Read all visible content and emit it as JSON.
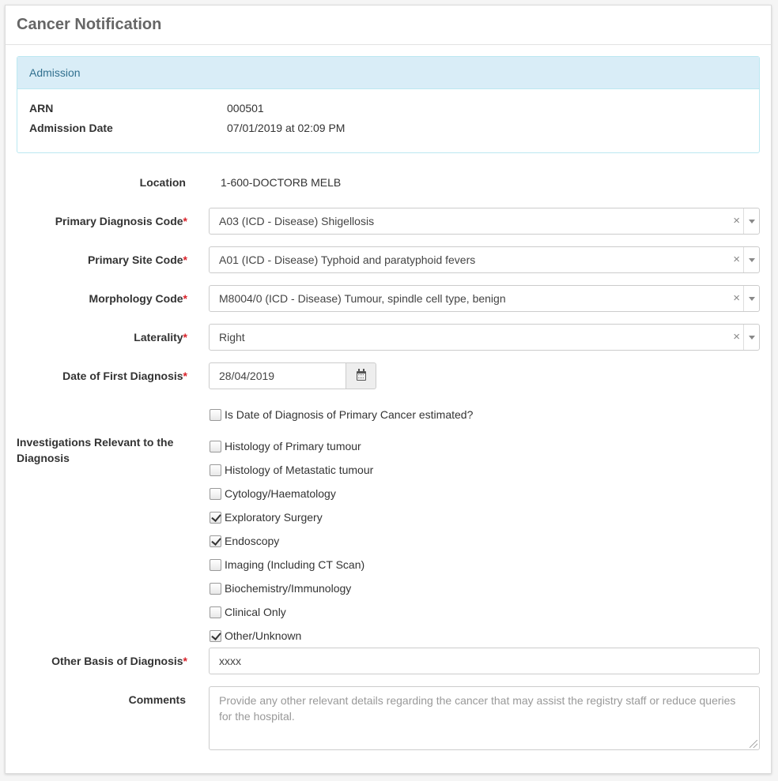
{
  "title": "Cancer Notification",
  "admission": {
    "heading": "Admission",
    "arn_label": "ARN",
    "arn_value": "000501",
    "date_label": "Admission Date",
    "date_value": "07/01/2019 at 02:09 PM"
  },
  "required_marker": "*",
  "location": {
    "label": "Location",
    "value": "1-600-DOCTORB MELB"
  },
  "primary_diagnosis": {
    "label": "Primary Diagnosis Code",
    "value": "A03 (ICD - Disease) Shigellosis"
  },
  "primary_site": {
    "label": "Primary Site Code",
    "value": "A01 (ICD - Disease) Typhoid and paratyphoid fevers"
  },
  "morphology": {
    "label": "Morphology Code",
    "value": "M8004/0 (ICD - Disease) Tumour, spindle cell type, benign"
  },
  "laterality": {
    "label": "Laterality",
    "value": "Right"
  },
  "first_diagnosis_date": {
    "label": "Date of First Diagnosis",
    "value": "28/04/2019"
  },
  "clear_symbol": "×",
  "estimated": {
    "label": "Is Date of Diagnosis of Primary Cancer estimated?",
    "checked": false
  },
  "investigations": {
    "label": "Investigations Relevant to the Diagnosis",
    "items": [
      {
        "label": "Histology of Primary tumour",
        "checked": false
      },
      {
        "label": "Histology of Metastatic tumour",
        "checked": false
      },
      {
        "label": "Cytology/Haematology",
        "checked": false
      },
      {
        "label": "Exploratory Surgery",
        "checked": true
      },
      {
        "label": "Endoscopy",
        "checked": true
      },
      {
        "label": "Imaging (Including CT Scan)",
        "checked": false
      },
      {
        "label": "Biochemistry/Immunology",
        "checked": false
      },
      {
        "label": "Clinical Only",
        "checked": false
      },
      {
        "label": "Other/Unknown",
        "checked": true
      }
    ]
  },
  "other_basis": {
    "label": "Other Basis of Diagnosis",
    "value": "xxxx"
  },
  "comments": {
    "label": "Comments",
    "placeholder": "Provide any other relevant details regarding the cancer that may assist the registry staff or reduce queries for the hospital."
  }
}
